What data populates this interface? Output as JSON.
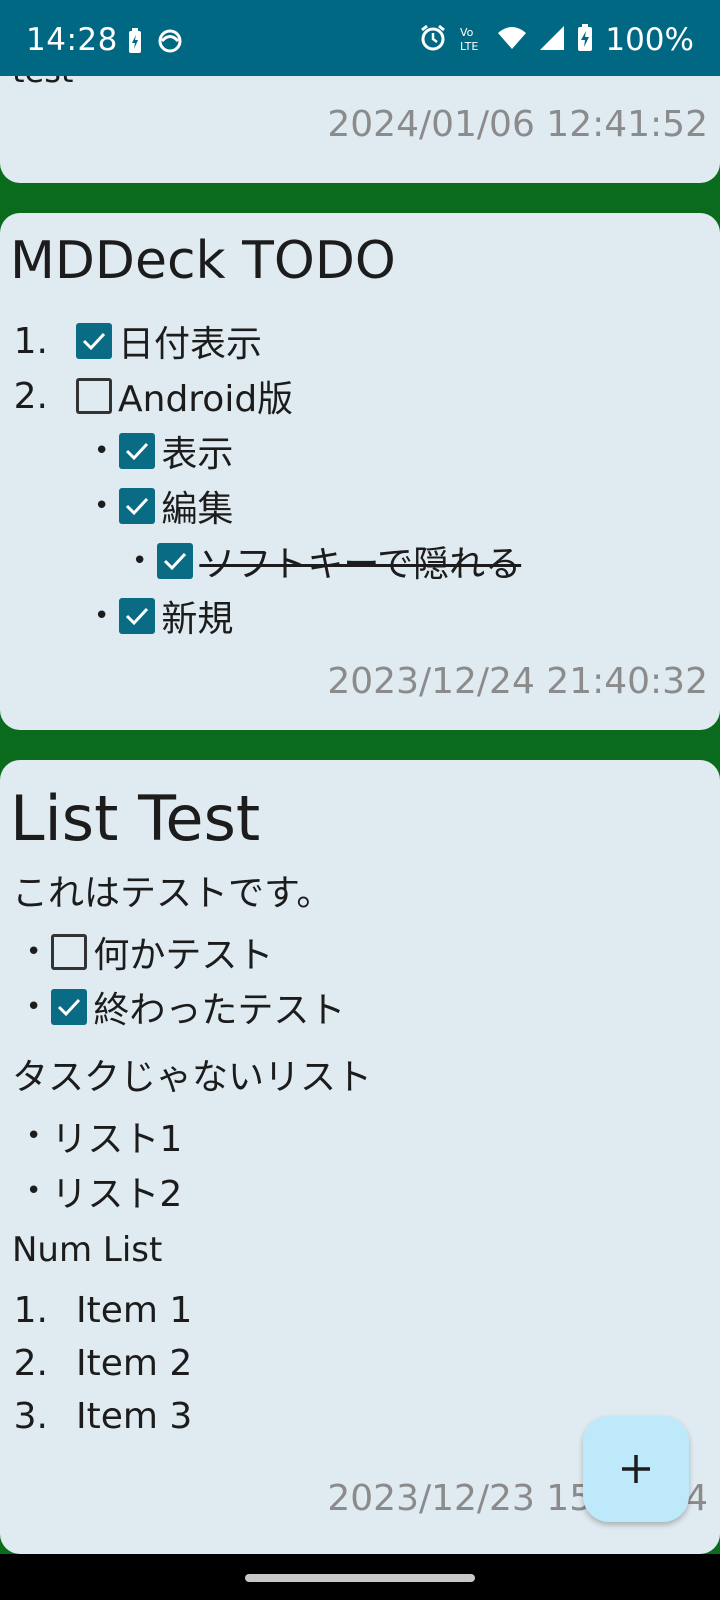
{
  "status_bar": {
    "time": "14:28",
    "battery_text": "100%",
    "icons": [
      "battery-saver-icon",
      "sync-icon",
      "alarm-icon",
      "volte-icon",
      "wifi-icon",
      "cellular-signal-icon",
      "battery-charging-icon"
    ]
  },
  "cards": [
    {
      "partial_text": "test",
      "timestamp": "2024/01/06 12:41:52"
    },
    {
      "title": "MDDeck TODO",
      "items": [
        {
          "marker": "1.",
          "checked": true,
          "text": "日付表示"
        },
        {
          "marker": "2.",
          "checked": false,
          "text": "Android版"
        },
        {
          "marker": "•",
          "checked": true,
          "text": "表示"
        },
        {
          "marker": "•",
          "checked": true,
          "text": "編集"
        },
        {
          "marker": "•",
          "checked": true,
          "text": "ソフトキーで隠れる",
          "strikethrough": true
        },
        {
          "marker": "•",
          "checked": true,
          "text": "新規"
        }
      ],
      "timestamp": "2023/12/24 21:40:32"
    },
    {
      "title": "List Test",
      "paragraph": "これはテストです。",
      "task_items": [
        {
          "marker": "•",
          "checked": false,
          "text": "何かテスト"
        },
        {
          "marker": "•",
          "checked": true,
          "text": "終わったテスト"
        }
      ],
      "subheading": "タスクじゃないリスト",
      "bullet_items": [
        {
          "marker": "•",
          "text": "リスト1"
        },
        {
          "marker": "•",
          "text": "リスト2"
        }
      ],
      "num_heading": "Num List",
      "num_items": [
        {
          "marker": "1.",
          "text": "Item 1"
        },
        {
          "marker": "2.",
          "text": "Item 2"
        },
        {
          "marker": "3.",
          "text": "Item 3"
        }
      ],
      "timestamp": "2023/12/23 15:39:44"
    }
  ],
  "fab": {
    "icon": "plus-icon"
  },
  "colors": {
    "status_bar": "#006882",
    "background": "#0b6b1d",
    "card": "#e0ebf1",
    "checkbox": "#0a6b85",
    "timestamp": "#8b8b8b",
    "fab": "#bde9fb"
  }
}
